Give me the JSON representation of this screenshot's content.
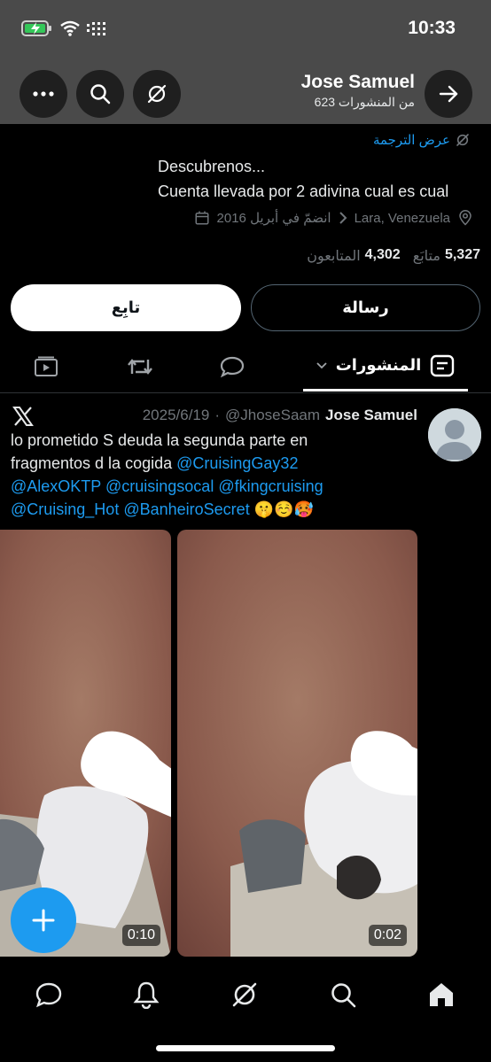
{
  "status": {
    "time": "10:33"
  },
  "header": {
    "name": "Jose Samuel",
    "posts_count": "623 من المنشورات"
  },
  "profile": {
    "translate_label": "عرض الترجمة",
    "bio_line1": "Descubrenos...",
    "bio_line2": "Cuenta llevada por 2 adivina cual es cual",
    "location": "Lara, Venezuela",
    "joined": "انضمّ في أبريل 2016",
    "following_count": "5,327",
    "following_label": "متابَع",
    "followers_count": "4,302",
    "followers_label": "المتابعون"
  },
  "actions": {
    "follow_label": "تابِع",
    "message_label": "رسالة"
  },
  "tabs": {
    "posts_label": "المنشورات"
  },
  "post": {
    "author": "Jose Samuel",
    "handle": "@JhoseSaam",
    "date": "2025/6/19",
    "text_line1": "lo prometido S deuda la segunda parte en",
    "text_line2": "fragmentos d la cogida ",
    "mention1": "@CruisingGay32",
    "mention2": "@AlexOKTP",
    "mention3": "@cruisingsocal",
    "mention4": "@fkingcruising",
    "mention5": "@Cruising_Hot",
    "mention6": "@BanheiroSecret",
    "emojis": "🤫☺️🥵",
    "video1_duration": "0:10",
    "video2_duration": "0:02"
  },
  "colors": {
    "accent": "#1d9bf0",
    "header_bg": "#4a4a4a",
    "background": "#000000"
  }
}
